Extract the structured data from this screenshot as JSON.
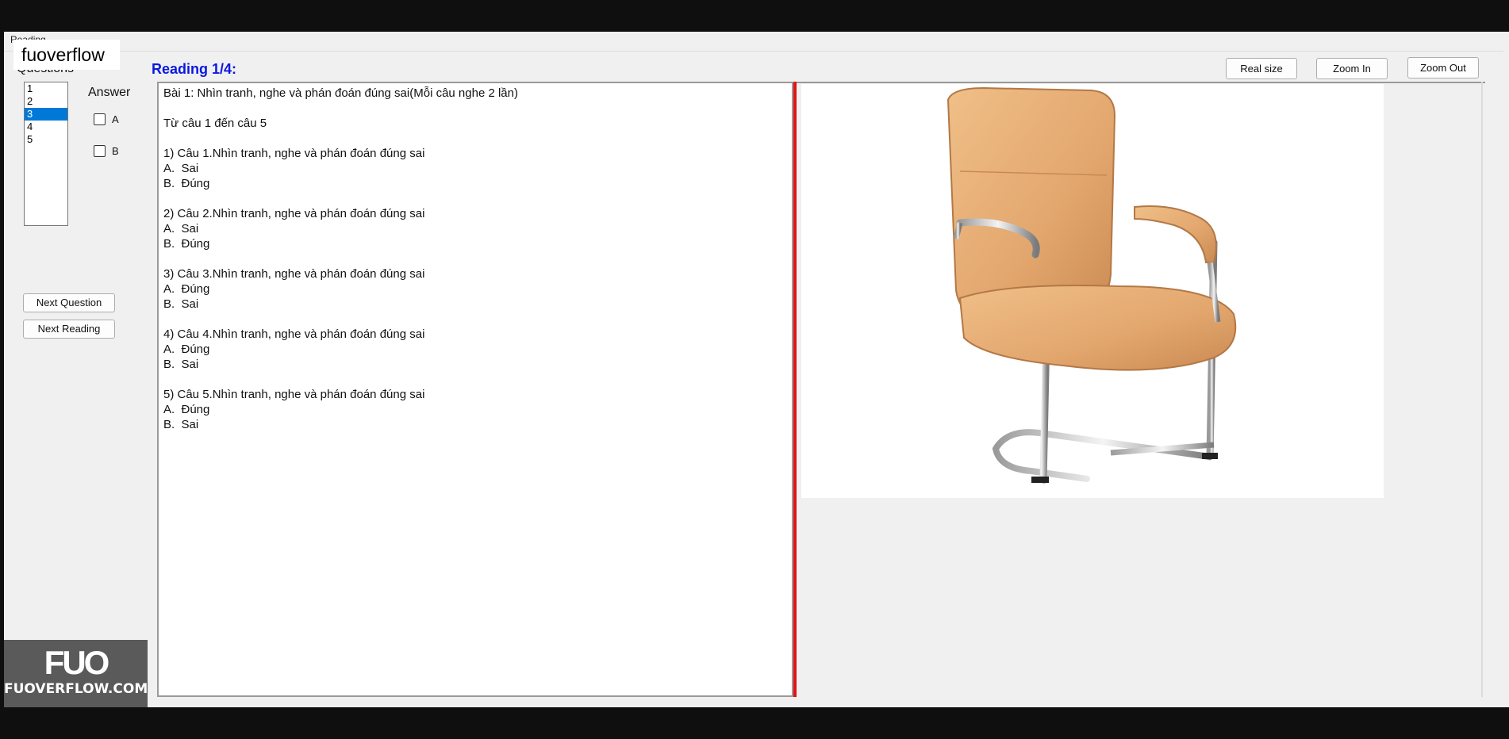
{
  "window": {
    "tab_label": "Reading"
  },
  "watermark": {
    "top_text": "fuoverflow",
    "logo_mark": "FUO",
    "logo_text": "FUOVERFLOW.COM"
  },
  "questions": {
    "label": "Questions",
    "items": [
      "1",
      "2",
      "3",
      "4",
      "5"
    ],
    "selected": "3"
  },
  "reading": {
    "title": "Reading 1/4:"
  },
  "answer": {
    "label": "Answer",
    "options": [
      "A",
      "B"
    ]
  },
  "buttons": {
    "next_question": "Next Question",
    "next_reading": "Next Reading",
    "real_size": "Real size",
    "zoom_in": "Zoom In",
    "zoom_out": "Zoom Out"
  },
  "content": {
    "lines": [
      "Bài 1: Nhìn tranh, nghe và phán đoán đúng sai(Mỗi câu nghe 2 lần)",
      "",
      "Từ câu 1 đến câu 5",
      "",
      "1) Câu 1.Nhìn tranh, nghe và phán đoán đúng sai",
      "A.  Sai",
      "B.  Đúng",
      "",
      "2) Câu 2.Nhìn tranh, nghe và phán đoán đúng sai",
      "A.  Sai",
      "B.  Đúng",
      "",
      "3) Câu 3.Nhìn tranh, nghe và phán đoán đúng sai",
      "A.  Đúng",
      "B.  Sai",
      "",
      "4) Câu 4.Nhìn tranh, nghe và phán đoán đúng sai",
      "A.  Đúng",
      "B.  Sai",
      "",
      "5) Câu 5.Nhìn tranh, nghe và phán đoán đúng sai",
      "A.  Đúng",
      "B.  Sai"
    ]
  },
  "colors": {
    "accent_title": "#0a18e0",
    "selection": "#0078d7",
    "divider": "#e31313",
    "chair": "#e8b07a"
  }
}
